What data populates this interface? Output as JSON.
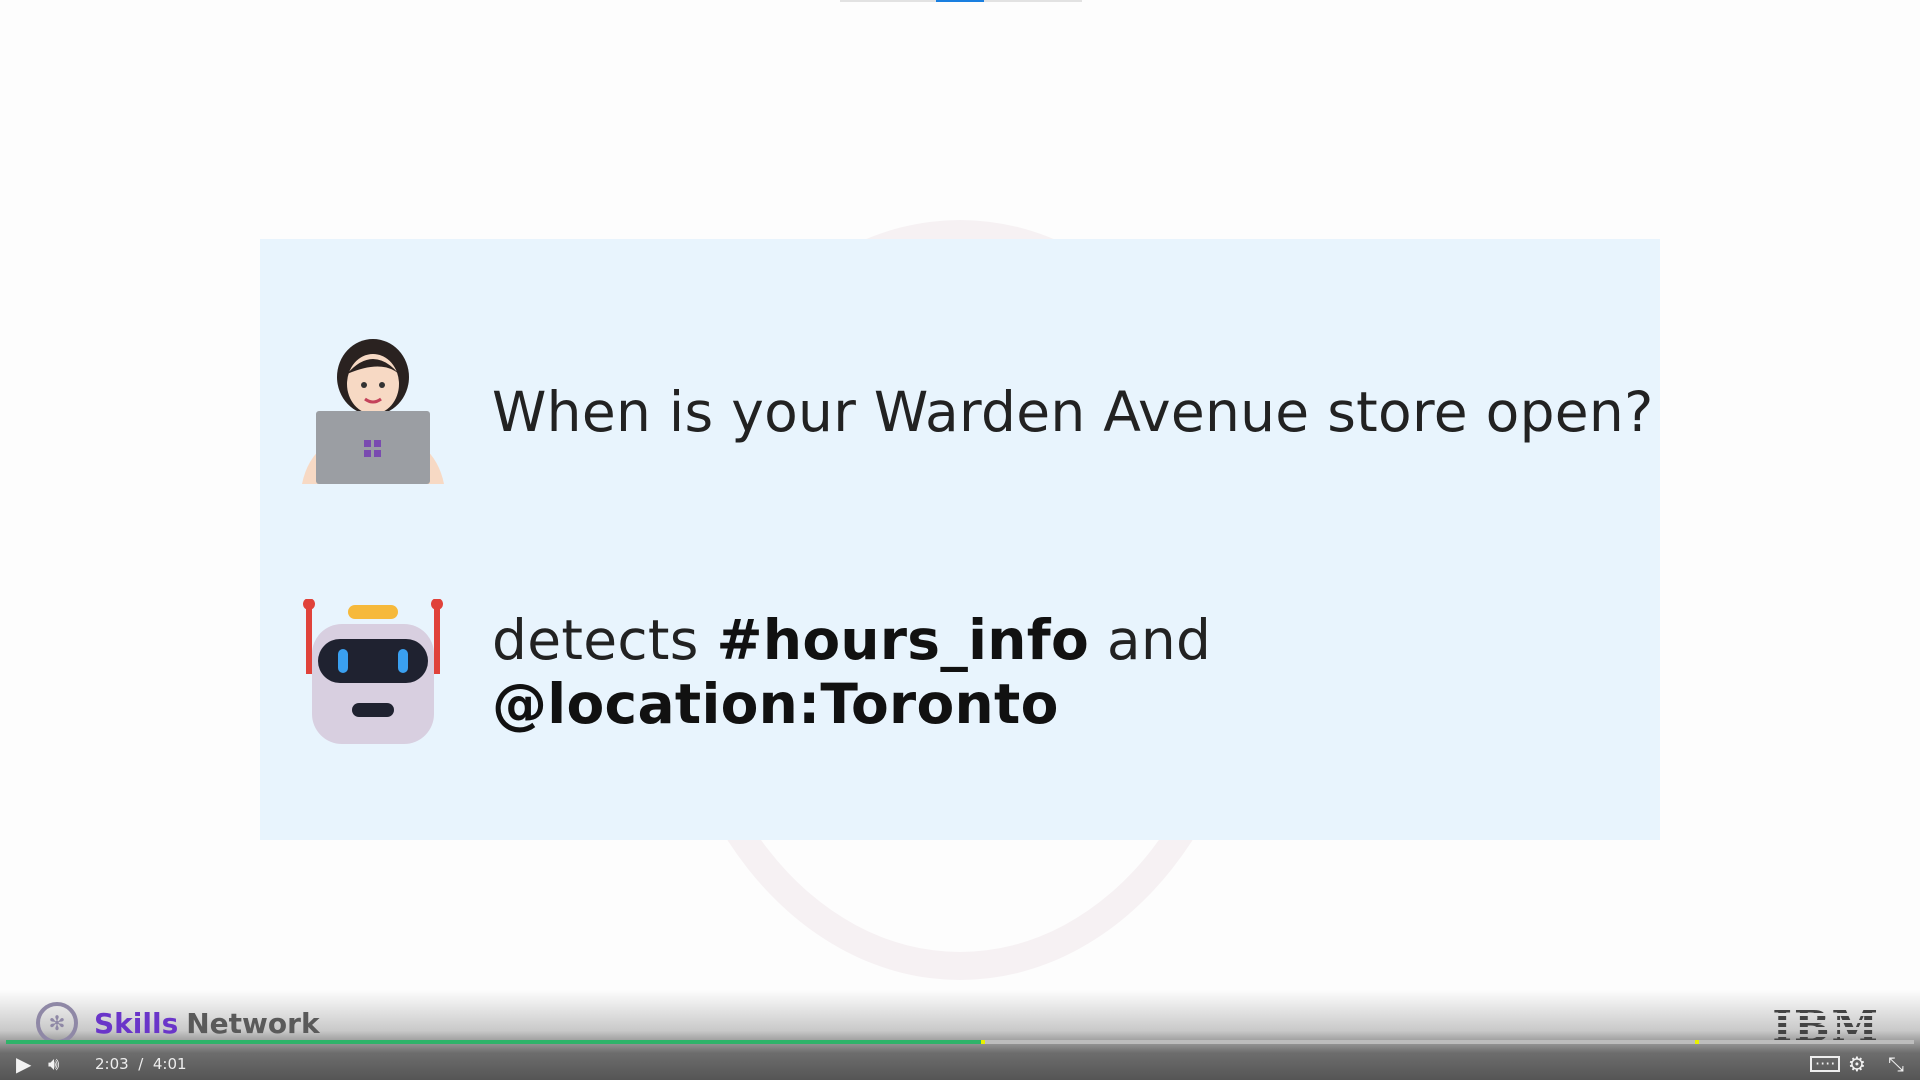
{
  "slide": {
    "user_message": "When is your Warden Avenue store open?",
    "bot_prefix": "detects ",
    "intent": "#hours_info",
    "conjunction": " and ",
    "entity": "@location:Toronto"
  },
  "branding": {
    "skills": "Skills",
    "network": "Network",
    "ibm": "IBM"
  },
  "player": {
    "current_time": "2:03",
    "separator": "/",
    "duration": "4:01",
    "progress_percent": 51.1,
    "chapter_markers_percent": [
      51.1,
      88.5
    ]
  },
  "colors": {
    "accent": "#6a35c9",
    "progress": "#2fb36a",
    "slide_bg": "#e8f4fd"
  }
}
